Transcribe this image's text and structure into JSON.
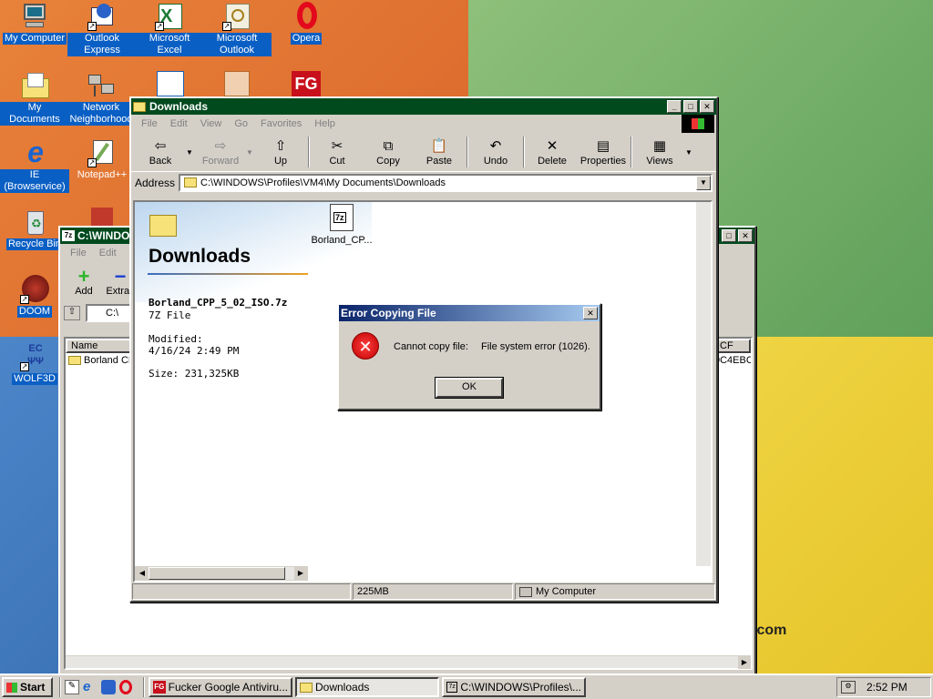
{
  "desktop": {
    "icons": [
      {
        "label": "My Computer",
        "icon": "my-computer-icon"
      },
      {
        "label": "Outlook Express",
        "icon": "outlook-express-icon"
      },
      {
        "label": "Microsoft Excel",
        "icon": "excel-icon"
      },
      {
        "label": "Microsoft Outlook",
        "icon": "outlook-icon"
      },
      {
        "label": "Opera",
        "icon": "opera-icon"
      },
      {
        "label": "My Documents",
        "icon": "my-documents-icon"
      },
      {
        "label": "Network Neighborhood",
        "icon": "network-icon"
      },
      {
        "label": "IE (Browservice)",
        "icon": "internet-explorer-icon"
      },
      {
        "label": "Notepad++",
        "icon": "notepad-icon"
      },
      {
        "label": "Recycle Bin",
        "icon": "recycle-bin-icon"
      },
      {
        "label": "DOOM",
        "icon": "doom-icon"
      },
      {
        "label": "WOLF3D",
        "icon": "wolf3d-icon"
      }
    ],
    "watermark": ".com"
  },
  "back_window": {
    "title": "C:\\WINDO",
    "menu": [
      "File",
      "Edit",
      "Vi"
    ],
    "tools": [
      "Add",
      "Extrac"
    ],
    "address": "C:\\",
    "columns": [
      "Name",
      "CF"
    ],
    "row_name": "Borland CPI",
    "row_crc": "9C4EBCI"
  },
  "explorer": {
    "title": "Downloads",
    "menu": [
      "File",
      "Edit",
      "View",
      "Go",
      "Favorites",
      "Help"
    ],
    "toolbar": [
      "Back",
      "Forward",
      "Up",
      "Cut",
      "Copy",
      "Paste",
      "Undo",
      "Delete",
      "Properties",
      "Views"
    ],
    "address_label": "Address",
    "address": "C:\\WINDOWS\\Profiles\\VM4\\My Documents\\Downloads",
    "folder_heading": "Downloads",
    "file_name": "Borland_CPP_5_02_ISO.7z",
    "file_type": "7Z File",
    "modified_label": "Modified:",
    "modified": "4/16/24 2:49 PM",
    "size": "Size: 231,325KB",
    "icon_label": "Borland_CP...",
    "icon_badge": "7z",
    "status_size": "225MB",
    "status_zone": "My Computer"
  },
  "dialog": {
    "title": "Error Copying File",
    "message": "Cannot copy file:",
    "detail": "File system error (1026).",
    "ok": "OK"
  },
  "taskbar": {
    "start": "Start",
    "tasks": [
      "Fucker Google Antiviru...",
      "Downloads",
      "C:\\WINDOWS\\Profiles\\..."
    ],
    "clock": "2:52 PM"
  }
}
